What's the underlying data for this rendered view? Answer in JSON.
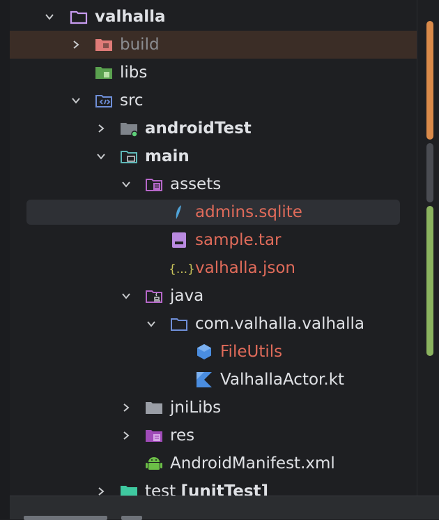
{
  "tree": {
    "rows": [
      {
        "label": "valhalla",
        "bold": true
      },
      {
        "label": "build"
      },
      {
        "label": "libs"
      },
      {
        "label": "src"
      },
      {
        "label": "androidTest",
        "bold": true
      },
      {
        "label": "main",
        "bold": true
      },
      {
        "label": "assets"
      },
      {
        "label": "admins.sqlite"
      },
      {
        "label": "sample.tar"
      },
      {
        "label": "valhalla.json"
      },
      {
        "label": "java"
      },
      {
        "label": "com.valhalla.valhalla"
      },
      {
        "label": "FileUtils"
      },
      {
        "label": "ValhallaActor.kt"
      },
      {
        "label": "jniLibs"
      },
      {
        "label": "res"
      },
      {
        "label": "AndroidManifest.xml"
      },
      {
        "label": "test",
        "extra": "[unitTest]"
      }
    ],
    "json_glyph": "{...}"
  },
  "colors": {
    "background": "#1e1f22",
    "text": "#dfe1e5",
    "modified_text": "#e06b5a",
    "excluded_text": "#8a8c90",
    "highlight_row": "#3b2d26",
    "selected_row": "#2e3035",
    "scroll_orange": "#d98a4a",
    "scroll_green": "#8bb35f"
  }
}
